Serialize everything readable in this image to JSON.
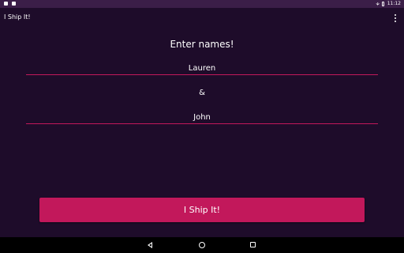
{
  "status_bar": {
    "time": "11:12"
  },
  "app_bar": {
    "title": "I Ship It!"
  },
  "main": {
    "heading": "Enter names!",
    "name1_value": "Lauren",
    "separator": "&",
    "name2_value": "John",
    "ship_button_label": "I Ship It!"
  },
  "colors": {
    "background": "#1e0c2a",
    "status_bar": "#3b1e48",
    "accent": "#c2185b"
  }
}
